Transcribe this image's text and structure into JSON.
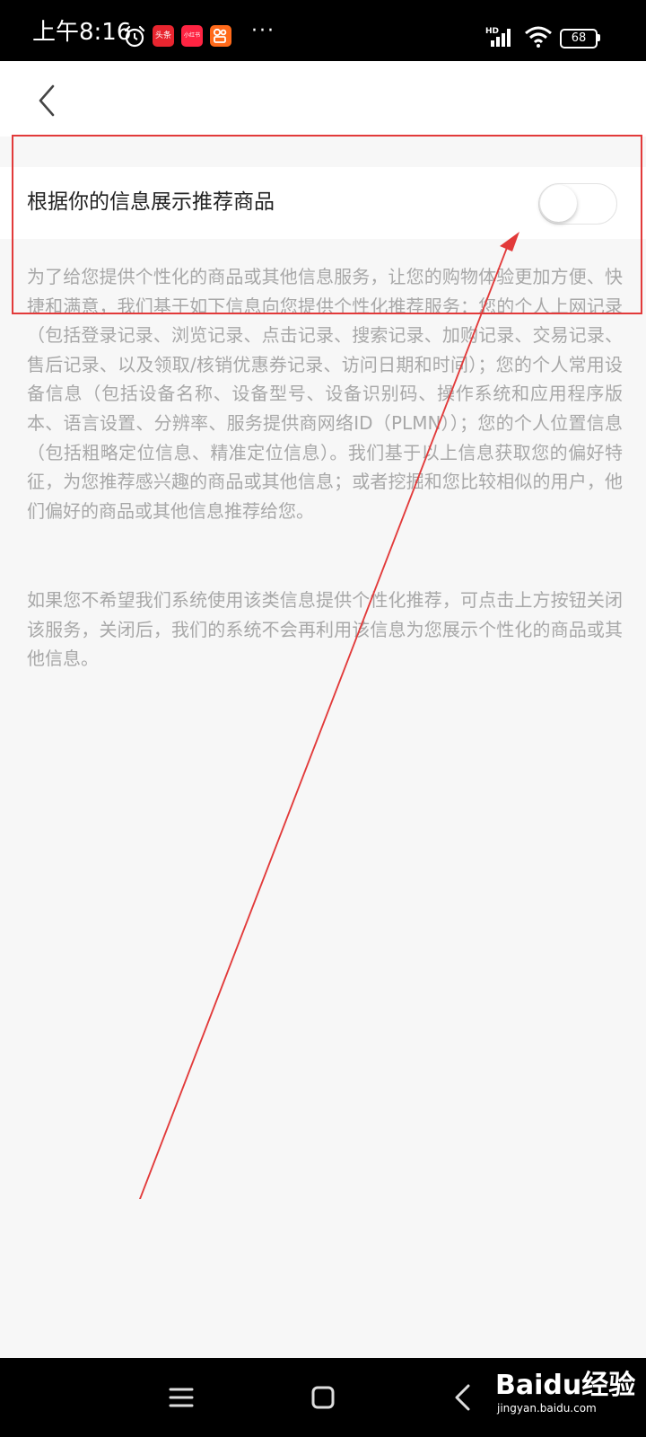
{
  "status_bar": {
    "time": "上午8:16",
    "apps": [
      {
        "name": "toutiao",
        "label": "头条",
        "color": "#e8252f"
      },
      {
        "name": "xiaohongshu",
        "label": "小红书",
        "color": "#ff2442"
      },
      {
        "name": "kuaishou",
        "label": "",
        "color": "#ff6a1a"
      }
    ],
    "more": "···",
    "network": "HD",
    "battery": "68"
  },
  "header": {
    "back_icon": "chevron-left-icon"
  },
  "setting": {
    "label": "根据你的信息展示推荐商品",
    "toggle_on": false
  },
  "description": {
    "paragraph_1": "为了给您提供个性化的商品或其他信息服务，让您的购物体验更加方便、快捷和满意，我们基于如下信息向您提供个性化推荐服务：您的个人上网记录（包括登录记录、浏览记录、点击记录、搜索记录、加购记录、交易记录、售后记录、以及领取/核销优惠券记录、访问日期和时间）；您的个人常用设备信息（包括设备名称、设备型号、设备识别码、操作系统和应用程序版本、语言设置、分辨率、服务提供商网络ID（PLMN））；您的个人位置信息（包括粗略定位信息、精准定位信息）。我们基于以上信息获取您的偏好特征，为您推荐感兴趣的商品或其他信息；或者挖掘和您比较相似的用户，他们偏好的商品或其他信息推荐给您。",
    "paragraph_2": "如果您不希望我们系统使用该类信息提供个性化推荐，可点击上方按钮关闭该服务，关闭后，我们的系统不会再利用该信息为您展示个性化的商品或其他信息。"
  },
  "annotation": {
    "color": "#e23a3a"
  },
  "nav_bar": {
    "menu_icon": "menu-icon",
    "home_icon": "square-icon",
    "back_icon": "chevron-left-icon",
    "watermark_brand": "Baidu经验",
    "watermark_url": "jingyan.baidu.com"
  }
}
